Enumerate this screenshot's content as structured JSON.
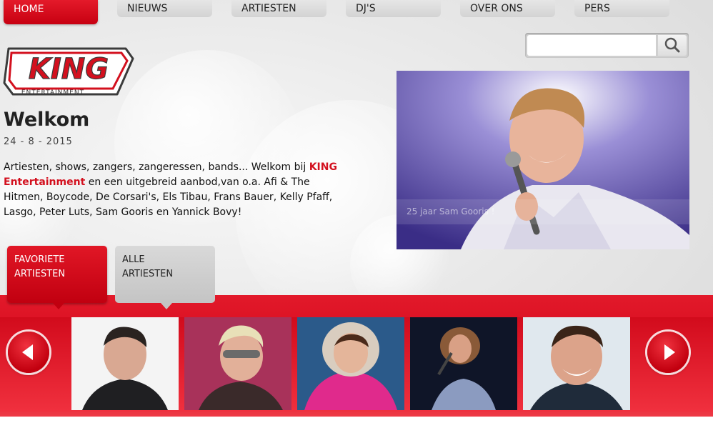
{
  "nav": {
    "items": [
      {
        "label": "HOME",
        "active": true
      },
      {
        "label": "NIEUWS",
        "active": false
      },
      {
        "label": "ARTIESTEN",
        "active": false
      },
      {
        "label": "DJ'S",
        "active": false
      },
      {
        "label": "OVER ONS",
        "active": false
      },
      {
        "label": "PERS",
        "active": false
      }
    ]
  },
  "search": {
    "value": "",
    "placeholder": "",
    "icon": "search-icon"
  },
  "logo": {
    "text": "KING",
    "subtext": "ENTERTAINMENT"
  },
  "welcome": {
    "title": "Welkom",
    "date": "24 - 8 - 2015",
    "intro_before": "Artiesten, shows, zangers, zangeressen, bands... Welkom bij ",
    "brand": "KING Entertainment",
    "intro_after": " en een uitgebreid aanbod,van o.a. Afi & The Hitmen, Boycode, De Corsari's, Els Tibau, Frans Bauer, Kelly Pfaff, Lasgo, Peter Luts, Sam Gooris en Yannick Bovy!"
  },
  "featured": {
    "caption": "25 jaar Sam Gooris !"
  },
  "tabs": {
    "favorites": {
      "line1": "FAVORIETE",
      "line2": "ARTIESTEN"
    },
    "all": {
      "line1": "ALLE",
      "line2": "ARTIESTEN"
    }
  },
  "carousel": {
    "prev_icon": "arrow-left-icon",
    "next_icon": "arrow-right-icon"
  },
  "colors": {
    "brand_red": "#d3101e",
    "nav_gray": "#d9d9d9"
  }
}
